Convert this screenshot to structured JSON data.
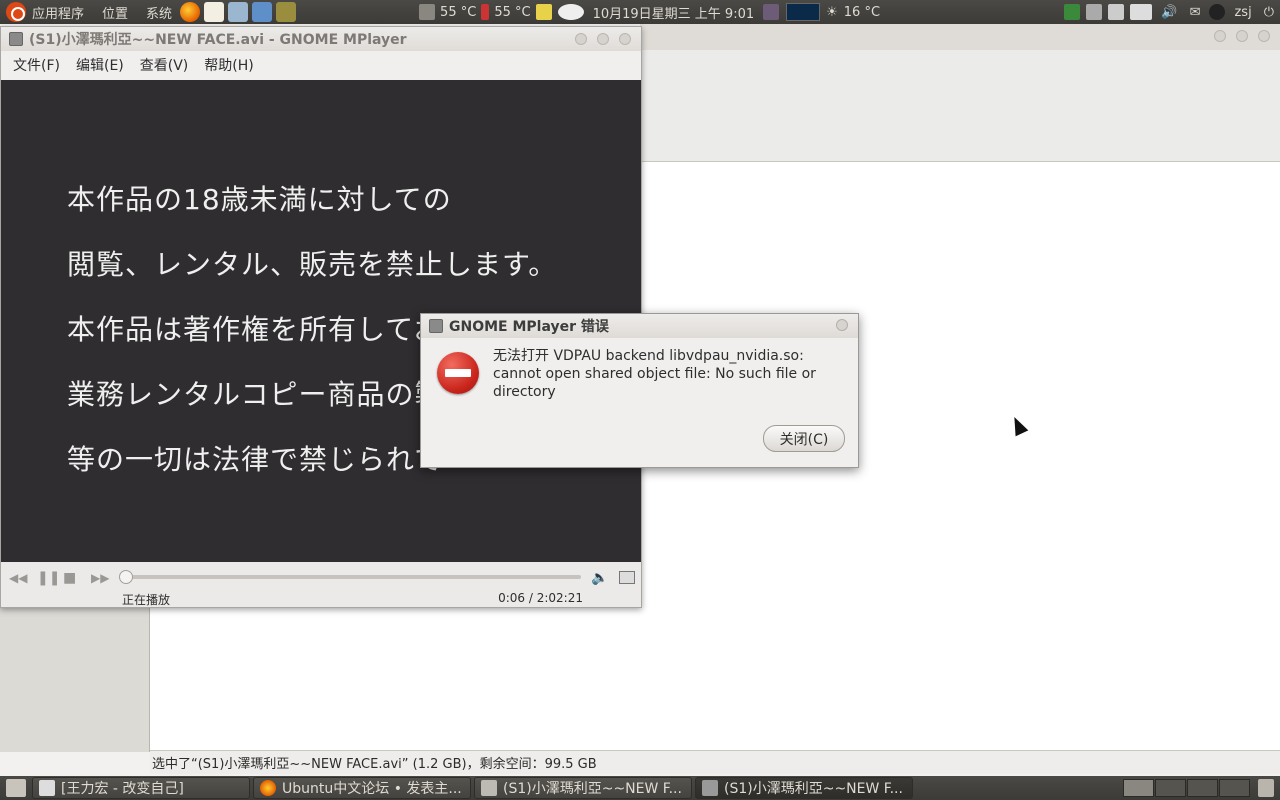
{
  "top_panel": {
    "menus": [
      "应用程序",
      "位置",
      "系统"
    ],
    "temp1": "55 °C",
    "temp2": "55 °C",
    "clock": "10月19日星期三 上午 9:01",
    "weather": "16 °C",
    "user": "zsj"
  },
  "mplayer": {
    "title": "(S1)小澤瑪利亞~~NEW FACE.avi - GNOME MPlayer",
    "menus": [
      "文件(F)",
      "编辑(E)",
      "查看(V)",
      "帮助(H)"
    ],
    "subtitles": [
      "本作品の18歳未満に対しての",
      "閲覧、レンタル、販売を禁止します。",
      "本作品は著作権を所有してお",
      "業務レンタルコピー商品の製",
      "等の一切は法律で禁じられて"
    ],
    "status": "正在播放",
    "time": "0:06 / 2:02:21",
    "progress": 0.001
  },
  "dialog": {
    "title": "GNOME MPlayer 错误",
    "message": "无法打开 VDPAU backend libvdpau_nvidia.so: cannot open shared object file: No such file or directory",
    "close_label": "关闭(C)"
  },
  "nautilus": {
    "status": "选中了“(S1)小澤瑪利亞~~NEW FACE.avi” (1.2 GB)，剩余空间：99.5 GB"
  },
  "taskbar": {
    "tasks": [
      "[王力宏 - 改变自己]",
      "Ubuntu中文论坛 • 发表主...",
      "(S1)小澤瑪利亞~~NEW F...",
      "(S1)小澤瑪利亞~~NEW F..."
    ]
  }
}
